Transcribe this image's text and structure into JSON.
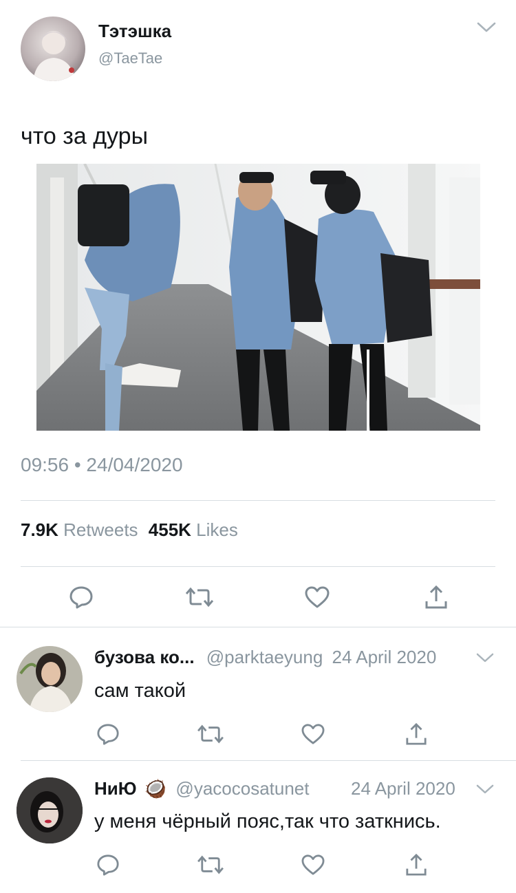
{
  "tweet": {
    "author_name": "Тэтэшка",
    "author_handle": "@TaeTae",
    "text": "что за дуры",
    "timestamp": "09:56 • 24/04/2020",
    "retweets_count": "7.9K",
    "retweets_label": "Retweets",
    "likes_count": "455K",
    "likes_label": "Likes"
  },
  "replies": [
    {
      "name": "бузова ко...",
      "handle": "@parktaeyung",
      "date": "24 April 2020",
      "text": "сам такой"
    },
    {
      "name": "НиЮ",
      "badge_emoji": "🥥",
      "handle": "@yacocosatunet",
      "date": "24 April 2020",
      "text": "у меня чёрный пояс,так что заткнись."
    }
  ],
  "icons": {
    "reply": "reply-icon",
    "retweet": "retweet-icon",
    "like": "heart-icon",
    "share": "share-icon",
    "menu": "chevron-down-icon"
  },
  "colors": {
    "text": "#14171a",
    "muted": "#8a969f",
    "icon": "#7f8b94",
    "divider": "#d7dde2"
  }
}
